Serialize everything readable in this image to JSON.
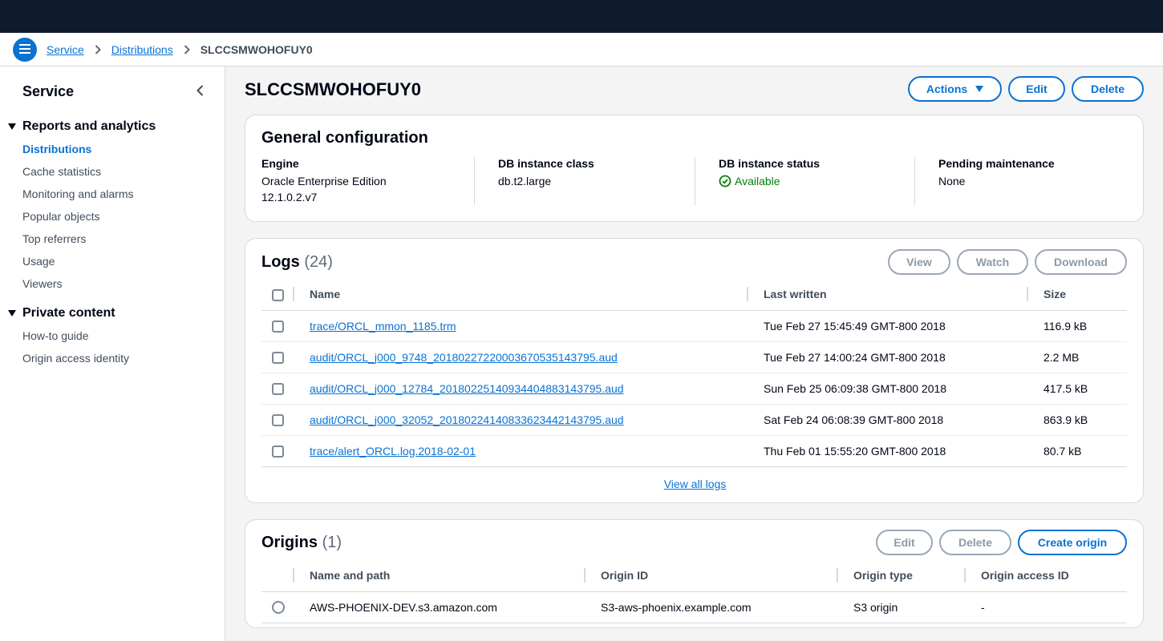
{
  "breadcrumb": {
    "items": [
      "Service",
      "Distributions"
    ],
    "current": "SLCCSMWOHOFUY0"
  },
  "sidebar": {
    "header": "Service",
    "sections": [
      {
        "label": "Reports and analytics",
        "items": [
          "Distributions",
          "Cache statistics",
          "Monitoring and alarms",
          "Popular objects",
          "Top referrers",
          "Usage",
          "Viewers"
        ]
      },
      {
        "label": "Private content",
        "items": [
          "How-to guide",
          "Origin access identity"
        ]
      }
    ]
  },
  "page": {
    "title": "SLCCSMWOHOFUY0",
    "actions_label": "Actions",
    "edit_label": "Edit",
    "delete_label": "Delete"
  },
  "general": {
    "title": "General configuration",
    "engine_key": "Engine",
    "engine_val_1": "Oracle Enterprise Edition",
    "engine_val_2": "12.1.0.2.v7",
    "class_key": "DB instance class",
    "class_val": "db.t2.large",
    "status_key": "DB instance status",
    "status_val": "Available",
    "maint_key": "Pending maintenance",
    "maint_val": "None",
    "status_color": "#037f0c"
  },
  "logs": {
    "title": "Logs",
    "count": "(24)",
    "view_label": "View",
    "watch_label": "Watch",
    "download_label": "Download",
    "columns": [
      "Name",
      "Last written",
      "Size"
    ],
    "rows": [
      {
        "name": "trace/ORCL_mmon_1185.trm",
        "written": "Tue Feb 27 15:45:49 GMT-800 2018",
        "size": "116.9 kB"
      },
      {
        "name": "audit/ORCL_j000_9748_20180227220003670535143795.aud",
        "written": "Tue Feb 27 14:00:24 GMT-800 2018",
        "size": "2.2 MB"
      },
      {
        "name": "audit/ORCL_j000_12784_20180225140934404883143795.aud",
        "written": "Sun Feb 25 06:09:38 GMT-800 2018",
        "size": "417.5 kB"
      },
      {
        "name": "audit/ORCL_j000_32052_20180224140833623442143795.aud",
        "written": "Sat Feb 24 06:08:39 GMT-800 2018",
        "size": "863.9 kB"
      },
      {
        "name": "trace/alert_ORCL.log.2018-02-01",
        "written": "Thu Feb 01 15:55:20 GMT-800 2018",
        "size": "80.7 kB"
      }
    ],
    "view_all": "View all logs"
  },
  "origins": {
    "title": "Origins",
    "count": "(1)",
    "edit_label": "Edit",
    "delete_label": "Delete",
    "create_label": "Create origin",
    "columns": [
      "Name and path",
      "Origin ID",
      "Origin type",
      "Origin access ID"
    ],
    "rows": [
      {
        "name": "AWS-PHOENIX-DEV.s3.amazon.com",
        "id": "S3-aws-phoenix.example.com",
        "type": "S3 origin",
        "access": "-"
      }
    ]
  },
  "colors": {
    "topbar": "#0f1b2d",
    "accent": "#0972d3",
    "success": "#037f0c"
  }
}
